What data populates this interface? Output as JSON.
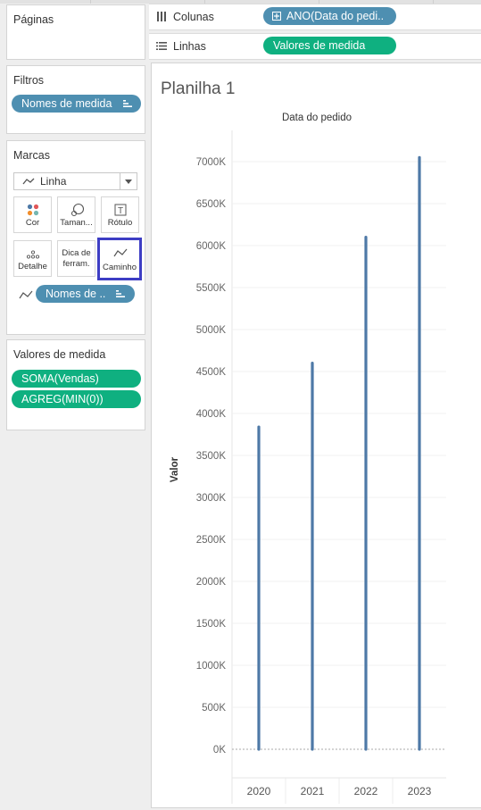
{
  "left_panel": {
    "pages": {
      "title": "Páginas"
    },
    "filters": {
      "title": "Filtros",
      "pill_label": "Nomes de medida"
    },
    "marks": {
      "title": "Marcas",
      "mark_type": "Linha",
      "buttons": {
        "color": "Cor",
        "size": "Taman...",
        "label": "Rótulo",
        "detail": "Detalhe",
        "tooltip_line1": "Dica de",
        "tooltip_line2": "ferram.",
        "path": "Caminho"
      },
      "path_pill": "Nomes de .."
    },
    "measure_values": {
      "title": "Valores de medida",
      "items": [
        "SOMA(Vendas)",
        "AGREG(MIN(0))"
      ]
    }
  },
  "shelves": {
    "columns": {
      "label": "Colunas",
      "pill": "ANO(Data do pedi.."
    },
    "rows": {
      "label": "Linhas",
      "pill": "Valores de medida"
    }
  },
  "sheet": {
    "title": "Planilha 1"
  },
  "colors": {
    "pill_blue": "#4e8fb1",
    "pill_green": "#0fb080",
    "line_color": "#4e79a7",
    "highlight": "#3d3dc4"
  },
  "chart_data": {
    "type": "line",
    "title": "Data do pedido",
    "xlabel": "",
    "ylabel": "Valor",
    "categories": [
      "2020",
      "2021",
      "2022",
      "2023"
    ],
    "series": [
      {
        "name": "SOMA(Vendas)",
        "values": [
          3840000,
          4600000,
          6100000,
          7050000
        ]
      },
      {
        "name": "AGREG(MIN(0))",
        "values": [
          0,
          0,
          0,
          0
        ]
      }
    ],
    "ylim": [
      0,
      7000000
    ],
    "yticks": [
      "0K",
      "500K",
      "1000K",
      "1500K",
      "2000K",
      "2500K",
      "3000K",
      "3500K",
      "4000K",
      "4500K",
      "5000K",
      "5500K",
      "6000K",
      "6500K",
      "7000K"
    ],
    "grid": true
  }
}
